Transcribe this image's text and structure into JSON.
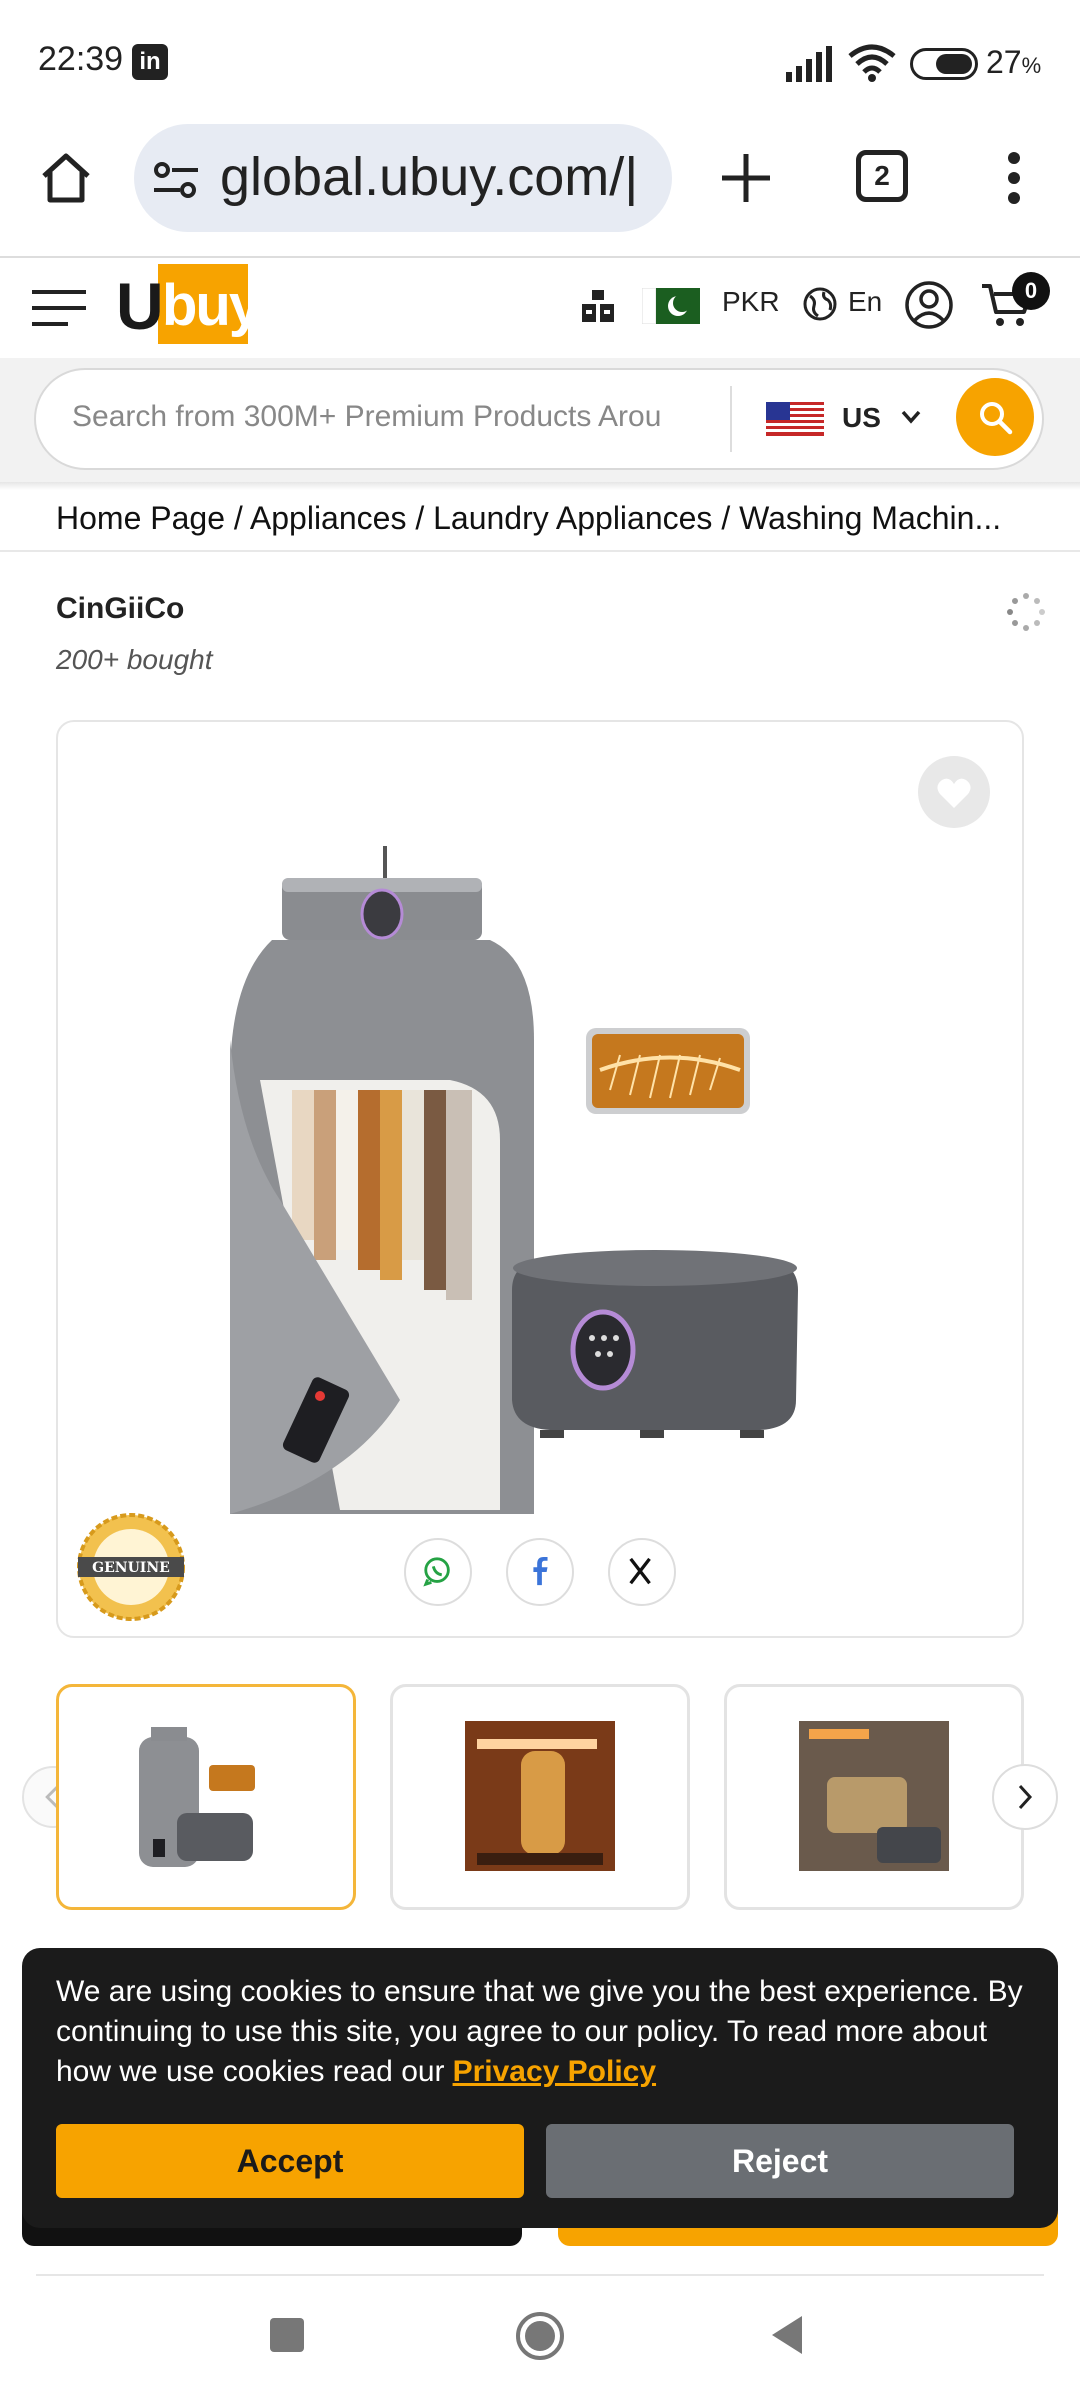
{
  "status_bar": {
    "time": "22:39",
    "notification_icon": "linkedin-icon",
    "battery": "27",
    "battery_unit": "%"
  },
  "browser": {
    "url": "global.ubuy.com/|",
    "tab_count": "2"
  },
  "site": {
    "logo_u": "U",
    "logo_buy": "buy",
    "currency": "PKR",
    "language": "En",
    "cart_count": "0"
  },
  "search": {
    "placeholder": "Search from 300M+ Premium Products Arou",
    "country": "US"
  },
  "breadcrumb": {
    "text": "Home Page / Appliances / Laundry Appliances / Washing Machin..."
  },
  "product": {
    "brand": "CinGiiCo",
    "sold": "200+ bought"
  },
  "cookie": {
    "message": "We are using cookies to ensure that we give you the best experience. By continuing to use this site, you agree to our policy. To read more about how we use cookies read our",
    "policy_link": "Privacy Policy",
    "accept": "Accept",
    "reject": "Reject"
  },
  "colors": {
    "brand_accent": "#f7a300",
    "cookie_bg": "#1b1b1b",
    "reject_bg": "#6a6e73"
  }
}
